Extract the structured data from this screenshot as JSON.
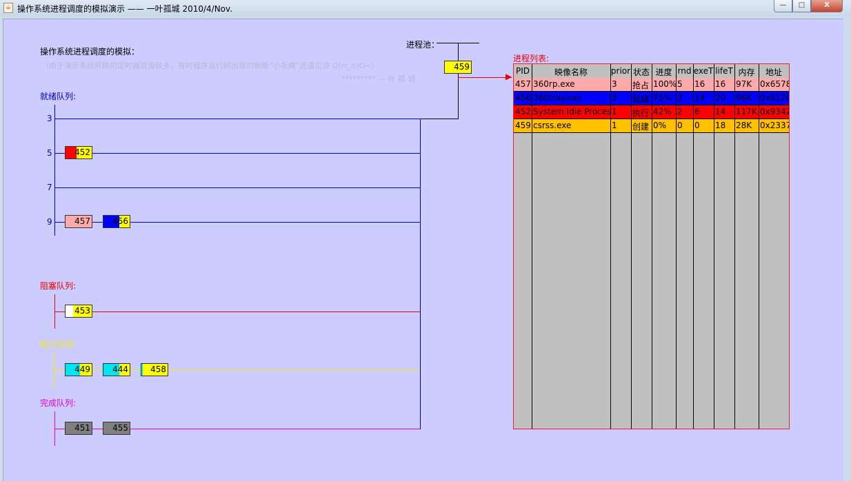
{
  "window": {
    "title": "操作系统进程调度的模拟演示 ——  一叶孤城 2010/4/Nov.",
    "buttons": {
      "minimize": "—",
      "maximize": "□",
      "close": "X"
    }
  },
  "header": {
    "heading": "操作系统进程调度的模拟：",
    "note": "（由于演示系统开辟的定时器资源较多，有时程序运行时出现的刷新“小毛病”还请见谅  O(∩_∩)O~）",
    "author": "*********  — 叶 孤 城"
  },
  "pool": {
    "label": "进程池：",
    "current": "459"
  },
  "ready": {
    "label": "就绪队列:",
    "levels": [
      {
        "priority": "3",
        "blocks": []
      },
      {
        "priority": "5",
        "blocks": [
          {
            "pid": "452",
            "fill": "#ff0000",
            "progress": 0.42
          }
        ]
      },
      {
        "priority": "7",
        "blocks": []
      },
      {
        "priority": "9",
        "blocks": [
          {
            "pid": "457",
            "fill": "#ffaaaa",
            "progress": 1.0
          },
          {
            "pid": "456",
            "fill": "#0000ff",
            "progress": 0.6
          }
        ]
      }
    ]
  },
  "blocked": {
    "label": "阻塞队列:",
    "blocks": [
      {
        "pid": "453",
        "fill": "#ffffff",
        "progress": 0.3
      }
    ]
  },
  "dead": {
    "label": "死亡队列:",
    "blocks": [
      {
        "pid": "449",
        "fill": "#00e5ee",
        "progress": 0.55
      },
      {
        "pid": "444",
        "fill": "#00e5ee",
        "progress": 0.6
      },
      {
        "pid": "458",
        "fill": "#00e5ee",
        "progress": 0.05
      }
    ]
  },
  "finished": {
    "label": "完成队列:",
    "blocks": [
      {
        "pid": "451",
        "fill": "#808080",
        "progress": 1.0
      },
      {
        "pid": "455",
        "fill": "#808080",
        "progress": 1.0
      }
    ]
  },
  "process_list": {
    "label": "进程列表:",
    "columns": [
      "PID",
      "映像名称",
      "prior",
      "状态",
      "进度",
      "rnd",
      "exeT",
      "lifeT",
      "内存",
      "地址"
    ],
    "rows": [
      {
        "bg": "#ffaaaa",
        "cells": [
          "457",
          "360rp.exe",
          "3",
          "抢占",
          "100%",
          "5",
          "16",
          "16",
          "97K",
          "0x6578"
        ]
      },
      {
        "bg": "#0000ff",
        "cells": [
          "456",
          "360tray.exe",
          "3",
          "就绪",
          "75%",
          "3",
          "14",
          "20",
          "96K",
          "0x6170"
        ]
      },
      {
        "bg": "#ff0000",
        "cells": [
          "452",
          "System Idle Process",
          "1",
          "执行",
          "42%",
          "2",
          "6",
          "14",
          "117K",
          "0x9342"
        ]
      },
      {
        "bg": "#ffc000",
        "cells": [
          "459",
          "csrss.exe",
          "1",
          "创建",
          "0%",
          "0",
          "0",
          "18",
          "28K",
          "0x2337"
        ]
      }
    ]
  },
  "colors": {
    "ready": "#0000cc",
    "blocked": "#ee0000",
    "dead": "#eeee00",
    "finished": "#dd00dd",
    "pid_chip": "#ffff00"
  }
}
